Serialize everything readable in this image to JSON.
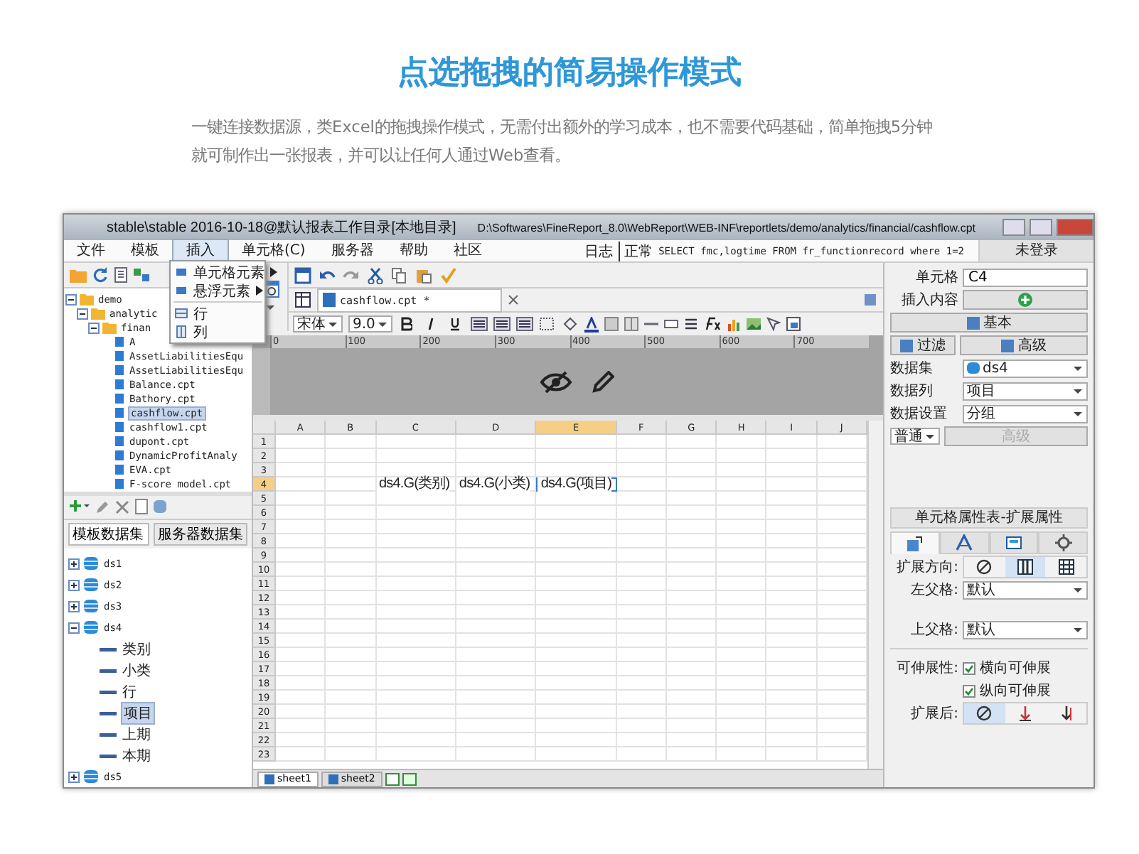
{
  "heading": {
    "title": "点选拖拽的简易操作模式",
    "description": "一键连接数据源，类Excel的拖拽操作模式，无需付出额外的学习成本，也不需要代码基础，简单拖拽5分钟就可制作出一张报表，并可以让任何人通过Web查看。"
  },
  "window": {
    "title": "stable\\stable 2016-10-18@默认报表工作目录[本地目录]",
    "path": "D:\\Softwares\\FineReport_8.0\\WebReport\\WEB-INF\\reportlets/demo/analytics/financial/cashflow.cpt",
    "menu": [
      {
        "label": "文件",
        "selected": false
      },
      {
        "label": "模板",
        "selected": false
      },
      {
        "label": "插入",
        "selected": true
      },
      {
        "label": "单元格(C)",
        "selected": false
      },
      {
        "label": "服务器",
        "selected": false
      },
      {
        "label": "帮助",
        "selected": false
      },
      {
        "label": "社区",
        "selected": false
      }
    ],
    "log": "日志",
    "status": "正常",
    "sql": "SELECT fmc,logtime FROM fr_functionrecord where 1=2",
    "login": "未登录"
  },
  "insert_menu": [
    {
      "label": "单元格元素",
      "kind": "submenu"
    },
    {
      "label": "悬浮元素",
      "kind": "submenu"
    },
    {
      "label": "行",
      "kind": "row"
    },
    {
      "label": "列",
      "kind": "column"
    }
  ],
  "file_tree": [
    {
      "label": "demo",
      "kind": "folder",
      "expanded": true,
      "children": [
        {
          "label": "analytic",
          "kind": "folder",
          "expanded": true,
          "children": [
            {
              "label": "finan",
              "kind": "folder",
              "expanded": true,
              "children": [
                {
                  "label": "A",
                  "kind": "file",
                  "selected": false
                },
                {
                  "label": "AssetLiabilitiesEqu",
                  "kind": "file",
                  "selected": false
                },
                {
                  "label": "AssetLiabilitiesEqu",
                  "kind": "file",
                  "selected": false
                },
                {
                  "label": "Balance.cpt",
                  "kind": "file",
                  "selected": false
                },
                {
                  "label": "Bathory.cpt",
                  "kind": "file",
                  "selected": false
                },
                {
                  "label": "cashflow.cpt",
                  "kind": "file",
                  "selected": true
                },
                {
                  "label": "cashflow1.cpt",
                  "kind": "file",
                  "selected": false
                },
                {
                  "label": "dupont.cpt",
                  "kind": "file",
                  "selected": false
                },
                {
                  "label": "DynamicProfitAnaly",
                  "kind": "file",
                  "selected": false
                },
                {
                  "label": "EVA.cpt",
                  "kind": "file",
                  "selected": false
                },
                {
                  "label": "F-score model.cpt",
                  "kind": "file",
                  "selected": false
                }
              ]
            }
          ]
        }
      ]
    }
  ],
  "dataset_tabs": [
    {
      "label": "模板数据集",
      "selected": true
    },
    {
      "label": "服务器数据集",
      "selected": false
    }
  ],
  "datasets": [
    {
      "label": "ds1",
      "kind": "dataset",
      "expanded": false
    },
    {
      "label": "ds2",
      "kind": "dataset",
      "expanded": false
    },
    {
      "label": "ds3",
      "kind": "dataset",
      "expanded": false
    },
    {
      "label": "ds4",
      "kind": "dataset",
      "expanded": true,
      "children": [
        {
          "label": "类别",
          "kind": "field",
          "selected": false
        },
        {
          "label": "小类",
          "kind": "field",
          "selected": false
        },
        {
          "label": "行",
          "kind": "field",
          "selected": false
        },
        {
          "label": "项目",
          "kind": "field",
          "selected": true
        },
        {
          "label": "上期",
          "kind": "field",
          "selected": false
        },
        {
          "label": "本期",
          "kind": "field",
          "selected": false
        }
      ]
    },
    {
      "label": "ds5",
      "kind": "dataset",
      "expanded": false
    }
  ],
  "editor": {
    "tab": "cashflow.cpt *",
    "font": "宋体",
    "font_size": "9.0",
    "ruler": [
      "0",
      "100",
      "200",
      "300",
      "400",
      "500",
      "600",
      "700"
    ]
  },
  "grid": {
    "columns": [
      {
        "label": "A",
        "selected": false
      },
      {
        "label": "B",
        "selected": false
      },
      {
        "label": "C",
        "selected": false
      },
      {
        "label": "D",
        "selected": false
      },
      {
        "label": "E",
        "selected": true
      },
      {
        "label": "F",
        "selected": false
      },
      {
        "label": "G",
        "selected": false
      },
      {
        "label": "H",
        "selected": false
      },
      {
        "label": "I",
        "selected": false
      },
      {
        "label": "J",
        "selected": false
      }
    ],
    "rows": [
      {
        "label": "1",
        "selected": false
      },
      {
        "label": "2",
        "selected": false
      },
      {
        "label": "3",
        "selected": false
      },
      {
        "label": "4",
        "selected": true,
        "cells": [
          {},
          {},
          {
            "text": "ds4.G(类别)",
            "selected": false
          },
          {
            "text": "ds4.G(小类)",
            "selected": false
          },
          {
            "text": "ds4.G(项目)",
            "selected": true
          },
          {},
          {},
          {},
          {},
          {}
        ]
      },
      {
        "label": "5",
        "selected": false
      },
      {
        "label": "6",
        "selected": false
      },
      {
        "label": "7",
        "selected": false
      },
      {
        "label": "8",
        "selected": false
      },
      {
        "label": "9",
        "selected": false
      },
      {
        "label": "10",
        "selected": false
      },
      {
        "label": "11",
        "selected": false
      },
      {
        "label": "12",
        "selected": false
      },
      {
        "label": "13",
        "selected": false
      },
      {
        "label": "14",
        "selected": false
      },
      {
        "label": "15",
        "selected": false
      },
      {
        "label": "16",
        "selected": false
      },
      {
        "label": "17",
        "selected": false
      },
      {
        "label": "18",
        "selected": false
      },
      {
        "label": "19",
        "selected": false
      },
      {
        "label": "20",
        "selected": false
      },
      {
        "label": "21",
        "selected": false
      },
      {
        "label": "22",
        "selected": false
      },
      {
        "label": "23",
        "selected": false
      }
    ]
  },
  "sheets": [
    {
      "label": "sheet1",
      "selected": true
    },
    {
      "label": "sheet2",
      "selected": false
    }
  ],
  "cell_panel": {
    "cell": {
      "label": "单元格",
      "value": "C4"
    },
    "insert_label": "插入内容",
    "basic": "基本",
    "filter": "过滤",
    "advanced": "高级",
    "dataset": {
      "label": "数据集",
      "value": "ds4"
    },
    "column": {
      "label": "数据列",
      "value": "项目"
    },
    "setting": {
      "label": "数据设置",
      "value": "分组"
    },
    "mode": "普通",
    "mode_button": {
      "label": "高级",
      "disabled": true
    }
  },
  "properties": {
    "title": "单元格属性表-扩展属性",
    "tabs": [
      {
        "kind": "expand",
        "selected": true
      },
      {
        "kind": "style",
        "selected": false
      },
      {
        "kind": "widget",
        "selected": false
      },
      {
        "kind": "other",
        "selected": false
      }
    ],
    "direction": {
      "label": "扩展方向:",
      "options": [
        {
          "kind": "none",
          "selected": false
        },
        {
          "kind": "vertical",
          "selected": true
        },
        {
          "kind": "horizontal",
          "selected": false
        }
      ]
    },
    "left_parent": {
      "label": "左父格:",
      "value": "默认"
    },
    "top_parent": {
      "label": "上父格:",
      "value": "默认"
    },
    "stretch": {
      "label": "可伸展性:",
      "options": [
        {
          "label": "横向可伸展",
          "checked": true
        },
        {
          "label": "纵向可伸展",
          "checked": true
        }
      ]
    },
    "after": {
      "label": "扩展后:",
      "options": [
        {
          "kind": "none",
          "selected": true
        },
        {
          "kind": "down",
          "selected": false
        },
        {
          "kind": "right",
          "selected": false
        }
      ]
    }
  }
}
